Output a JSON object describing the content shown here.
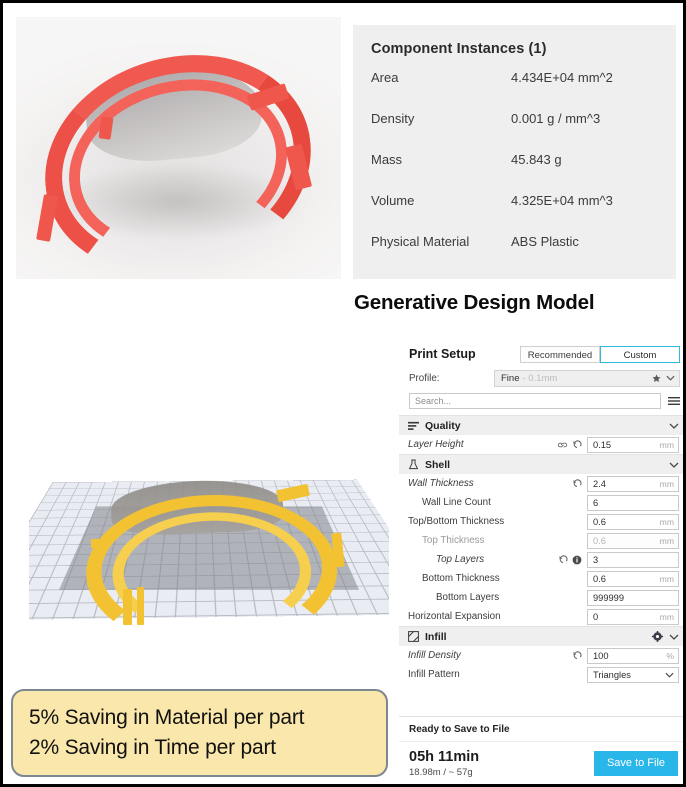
{
  "properties_panel": {
    "title": "Component Instances (1)",
    "rows": [
      {
        "label": "Area",
        "value": "4.434E+04 mm^2"
      },
      {
        "label": "Density",
        "value": "0.001 g / mm^3"
      },
      {
        "label": "Mass",
        "value": "45.843 g"
      },
      {
        "label": "Volume",
        "value": "4.325E+04 mm^3"
      },
      {
        "label": "Physical Material",
        "value": "ABS Plastic"
      }
    ]
  },
  "caption": {
    "generative_design_model": "Generative Design Model"
  },
  "savings_callout": {
    "line1": "5% Saving in Material per part",
    "line2": "2% Saving in Time per part",
    "background_color": "#fae7ab",
    "border_color": "#7d8792"
  },
  "print_setup": {
    "title": "Print Setup",
    "mode_recommended": "Recommended",
    "mode_custom": "Custom",
    "selected_mode": "Custom",
    "accent_color": "#31b8e0",
    "profile_label": "Profile:",
    "profile_value": "Fine",
    "profile_sub": "- 0.1mm",
    "search_placeholder": "Search...",
    "categories": [
      {
        "name": "Quality",
        "icon": "layers-icon",
        "has_gear": false,
        "settings": [
          {
            "label": "Layer Height",
            "value": "0.15",
            "unit": "mm",
            "indent": 0,
            "modified": true,
            "disabled": false,
            "link": true,
            "revert": true,
            "info": false,
            "type": "text"
          }
        ]
      },
      {
        "name": "Shell",
        "icon": "flask-icon",
        "has_gear": false,
        "settings": [
          {
            "label": "Wall Thickness",
            "value": "2.4",
            "unit": "mm",
            "indent": 0,
            "modified": true,
            "disabled": false,
            "link": false,
            "revert": true,
            "info": false,
            "type": "text"
          },
          {
            "label": "Wall Line Count",
            "value": "6",
            "unit": "",
            "indent": 1,
            "modified": false,
            "disabled": false,
            "link": false,
            "revert": false,
            "info": false,
            "type": "text"
          },
          {
            "label": "Top/Bottom Thickness",
            "value": "0.6",
            "unit": "mm",
            "indent": 0,
            "modified": false,
            "disabled": false,
            "link": false,
            "revert": false,
            "info": false,
            "type": "text"
          },
          {
            "label": "Top Thickness",
            "value": "0.6",
            "unit": "mm",
            "indent": 1,
            "modified": false,
            "disabled": true,
            "link": false,
            "revert": false,
            "info": false,
            "type": "text"
          },
          {
            "label": "Top Layers",
            "value": "3",
            "unit": "",
            "indent": 2,
            "modified": true,
            "disabled": false,
            "link": false,
            "revert": true,
            "info": true,
            "type": "text"
          },
          {
            "label": "Bottom Thickness",
            "value": "0.6",
            "unit": "mm",
            "indent": 1,
            "modified": false,
            "disabled": false,
            "link": false,
            "revert": false,
            "info": false,
            "type": "text"
          },
          {
            "label": "Bottom Layers",
            "value": "999999",
            "unit": "",
            "indent": 2,
            "modified": false,
            "disabled": false,
            "link": false,
            "revert": false,
            "info": false,
            "type": "text"
          },
          {
            "label": "Horizontal Expansion",
            "value": "0",
            "unit": "mm",
            "indent": 0,
            "modified": false,
            "disabled": false,
            "link": false,
            "revert": false,
            "info": false,
            "type": "text"
          }
        ]
      },
      {
        "name": "Infill",
        "icon": "infill-icon",
        "has_gear": true,
        "settings": [
          {
            "label": "Infill Density",
            "value": "100",
            "unit": "%",
            "indent": 0,
            "modified": true,
            "disabled": false,
            "link": false,
            "revert": true,
            "info": false,
            "type": "text"
          },
          {
            "label": "Infill Pattern",
            "value": "Triangles",
            "unit": "",
            "indent": 0,
            "modified": false,
            "disabled": false,
            "link": false,
            "revert": false,
            "info": false,
            "type": "select"
          }
        ]
      }
    ],
    "status_ready": "Ready to Save to File",
    "status_time": "05h 11min",
    "status_material": "18.98m / ~ 57g",
    "save_button": "Save to File",
    "save_button_color": "#29b6e8"
  }
}
